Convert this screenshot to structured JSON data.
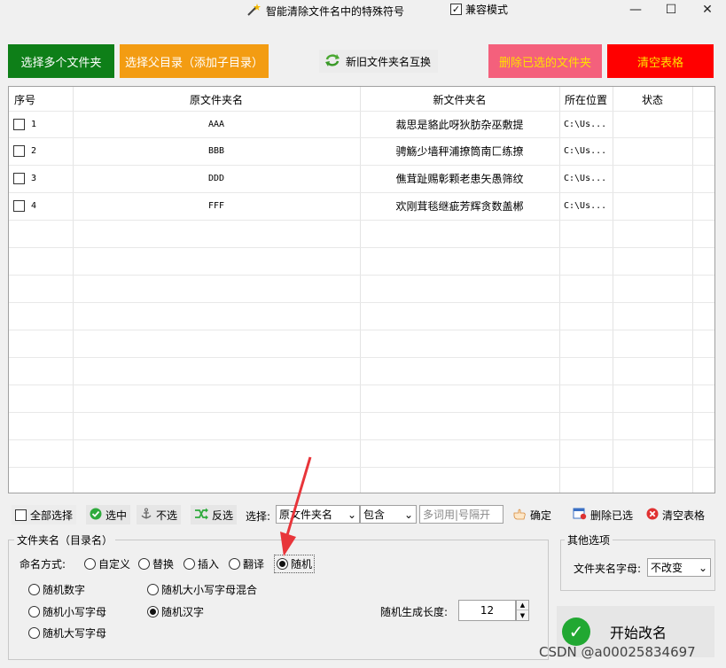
{
  "window": {
    "title": "智能清除文件名中的特殊符号",
    "compat_label": "兼容模式",
    "compat_checked": "✓",
    "minimize": "—",
    "maximize": "☐",
    "close": "✕"
  },
  "top_buttons": {
    "select_multi": "选择多个文件夹",
    "select_parent": "选择父目录（添加子目录）",
    "swap_names": "新旧文件夹名互换",
    "delete_selected": "删除已选的文件夹",
    "clear_table": "清空表格"
  },
  "table": {
    "headers": [
      "序号",
      "原文件夹名",
      "新文件夹名",
      "所在位置",
      "状态"
    ],
    "rows": [
      {
        "index": "1",
        "original": "AAA",
        "new": "裁思是貉此呀狄肪杂巫敷提",
        "location": "C:\\Us...",
        "status": ""
      },
      {
        "index": "2",
        "original": "BBB",
        "new": "骋觞少墙秤浦撩筒南匚练撩",
        "location": "C:\\Us...",
        "status": ""
      },
      {
        "index": "3",
        "original": "DDD",
        "new": "僬茸趾赐彰颗老患矢愚筛纹",
        "location": "C:\\Us...",
        "status": ""
      },
      {
        "index": "4",
        "original": "FFF",
        "new": "欢刚茸毯继疵芳辉贪数盖郴",
        "location": "C:\\Us...",
        "status": ""
      }
    ]
  },
  "toolbar": {
    "select_all": "全部选择",
    "select": "选中",
    "deselect": "不选",
    "invert": "反选",
    "choose_label": "选择:",
    "field_select": "原文件夹名",
    "mode_select": "包含",
    "keyword_placeholder": "多词用|号隔开",
    "confirm": "确定",
    "delete_selected": "删除已选",
    "clear_table": "清空表格"
  },
  "naming": {
    "group_title": "文件夹名（目录名）",
    "method_label": "命名方式:",
    "methods": [
      "自定义",
      "替换",
      "插入",
      "翻译",
      "随机"
    ],
    "selected_method": "随机",
    "random_options": [
      "随机数字",
      "随机小写字母",
      "随机大写字母",
      "随机大小写字母混合",
      "随机汉字"
    ],
    "selected_random": "随机汉字",
    "length_label": "随机生成长度:",
    "length_value": "12"
  },
  "other": {
    "group_title": "其他选项",
    "letter_label": "文件夹名字母:",
    "letter_value": "不改变"
  },
  "start_button": "开始改名",
  "watermark": "CSDN @a00025834697",
  "colors": {
    "green_button": "#0e7f18",
    "orange_button": "#f39c12",
    "pink_button": "#f4607c",
    "red_button": "#ff0000",
    "warning_text": "#ffe000",
    "arrow": "#e8353a"
  }
}
